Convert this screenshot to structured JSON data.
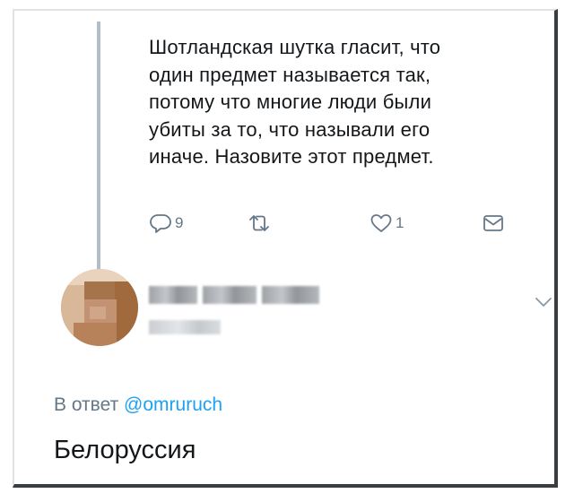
{
  "tweet": {
    "text_lines": [
      "Шотландская шутка гласит, что",
      "один предмет называется так,",
      "потому что многие люди были",
      "убиты за то, что называли его",
      "иначе. Назовите этот предмет."
    ],
    "actions": {
      "reply_icon": "reply-icon",
      "reply_count": "9",
      "retweet_icon": "retweet-icon",
      "like_icon": "heart-icon",
      "like_count": "1",
      "dm_icon": "envelope-icon"
    }
  },
  "reply": {
    "avatar": "blurred-avatar",
    "reply_to_prefix": "В ответ",
    "reply_to_handle": "@omruruch",
    "text": "Белоруссия"
  },
  "colors": {
    "text": "#14171a",
    "secondary": "#657786",
    "mention": "#1da1f2",
    "thread_line": "#b3bdc6"
  }
}
